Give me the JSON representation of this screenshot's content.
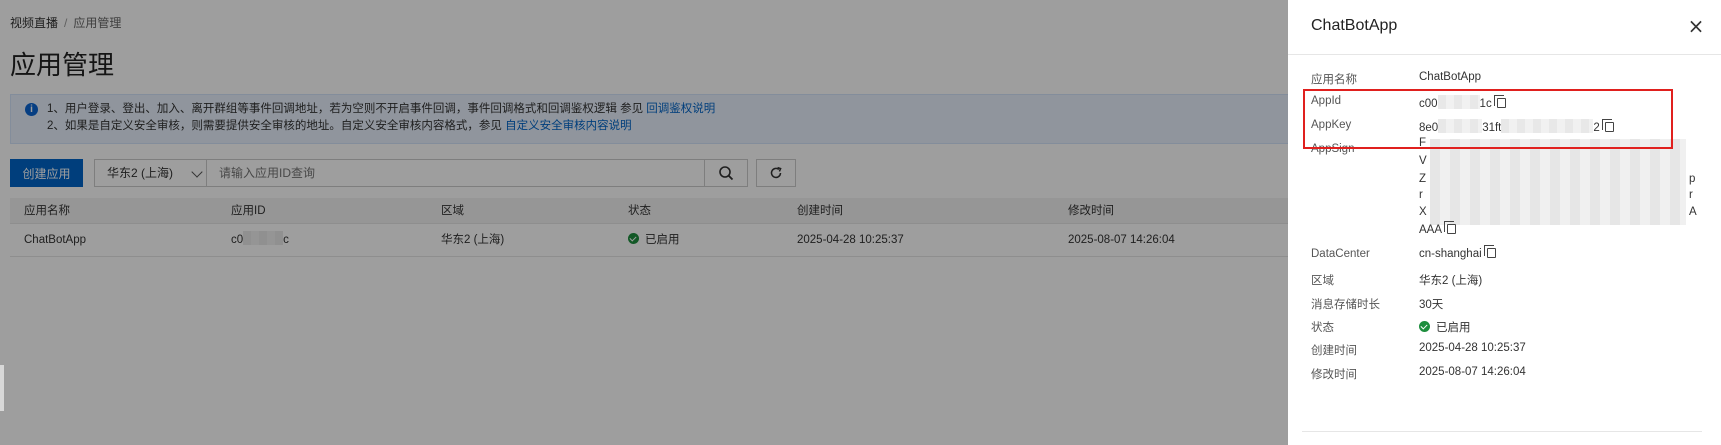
{
  "breadcrumb": {
    "root": "视频直播",
    "separator": "/",
    "current": "应用管理"
  },
  "page_title": "应用管理",
  "notice": {
    "line1_text": "1、用户登录、登出、加入、离开群组等事件回调地址，若为空则不开启事件回调，事件回调格式和回调鉴权逻辑 参见 ",
    "line1_link": "回调鉴权说明",
    "line2_text": "2、如果是自定义安全审核，则需要提供安全审核的地址。自定义安全审核内容格式，参见 ",
    "line2_link": "自定义安全审核内容说明"
  },
  "toolbar": {
    "create_label": "创建应用",
    "region_value": "华东2 (上海)",
    "search_placeholder": "请输入应用ID查询"
  },
  "table": {
    "headers": [
      "应用名称",
      "应用ID",
      "区域",
      "状态",
      "创建时间",
      "修改时间"
    ],
    "rows": [
      {
        "name": "ChatBotApp",
        "id_prefix": "c0",
        "id_suffix": "c",
        "region": "华东2 (上海)",
        "status": "已启用",
        "created": "2025-04-28 10:25:37",
        "modified": "2025-08-07 14:26:04"
      }
    ]
  },
  "drawer": {
    "title": "ChatBotApp",
    "close_symbol": "×",
    "labels": {
      "app_name": "应用名称",
      "app_id": "AppId",
      "app_key": "AppKey",
      "app_sign": "AppSign",
      "data_center": "DataCenter",
      "region": "区域",
      "retention": "消息存储时长",
      "status": "状态",
      "created": "创建时间",
      "modified": "修改时间"
    },
    "values": {
      "app_name": "ChatBotApp",
      "app_id_prefix": "c00",
      "app_id_suffix": "1c",
      "app_key_prefix": "8e0",
      "app_key_mid": "31ft",
      "app_key_suffix": "2",
      "app_sign_first": "F",
      "app_sign_line2": "V",
      "app_sign_line3": "Z",
      "app_sign_line4": "r",
      "app_sign_line5": "X",
      "app_sign_end3": "p",
      "app_sign_end4": "r",
      "app_sign_end5": "A",
      "app_sign_last": "AAA",
      "data_center": "cn-shanghai",
      "region": "华东2 (上海)",
      "retention": "30天",
      "status": "已启用",
      "created": "2025-04-28 10:25:37",
      "modified": "2025-08-07 14:26:04"
    }
  },
  "colors": {
    "primary": "#0064c8",
    "success": "#1e8e3e",
    "highlight": "#e0201e"
  }
}
